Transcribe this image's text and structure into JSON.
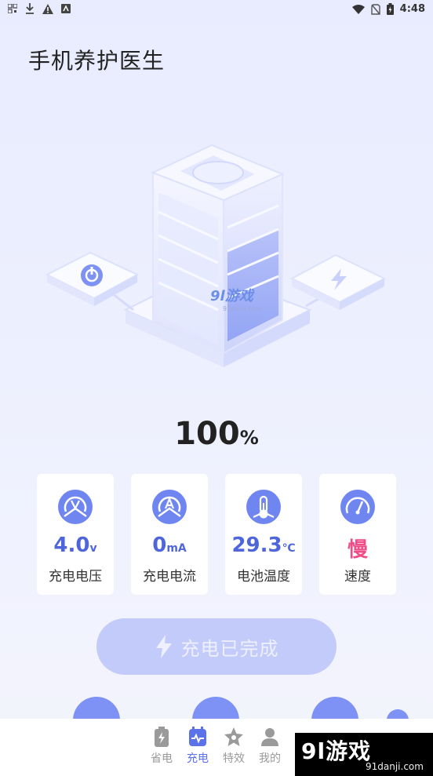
{
  "status_bar": {
    "left_icons": [
      "qr-icon",
      "download-icon",
      "warning-icon",
      "app-icon"
    ],
    "right_icons": [
      "wifi-icon",
      "no-sim-icon",
      "battery-icon"
    ],
    "time": "4:48"
  },
  "app": {
    "title": "手机养护医生"
  },
  "battery": {
    "percent": "100",
    "unit": "%"
  },
  "cards": [
    {
      "icon": "voltage-icon",
      "value": "4.0",
      "unit": "v",
      "label": "充电电压"
    },
    {
      "icon": "current-icon",
      "value": "0",
      "unit": "mA",
      "label": "充电电流"
    },
    {
      "icon": "thermometer-icon",
      "value": "29.3",
      "unit": "℃",
      "label": "电池温度"
    },
    {
      "icon": "speedometer-icon",
      "value": "慢",
      "unit": "",
      "label": "速度"
    }
  ],
  "charge_button": {
    "label": "充电已完成"
  },
  "tabs": [
    {
      "label": "省电",
      "icon": "battery-saver-icon",
      "active": false
    },
    {
      "label": "充电",
      "icon": "charging-icon",
      "active": true
    },
    {
      "label": "特效",
      "icon": "star-icon",
      "active": false
    },
    {
      "label": "我的",
      "icon": "profile-icon",
      "active": false
    }
  ],
  "watermark": {
    "text": "9l游戏",
    "sub": "91danji.com"
  },
  "illustration_watermark": {
    "text": "9l游戏",
    "sub": "91danji.com"
  },
  "colors": {
    "accent": "#6f86f1",
    "accent_text": "#4f66db",
    "speed_pink": "#ef4c88",
    "button": "#c3cbfa"
  }
}
